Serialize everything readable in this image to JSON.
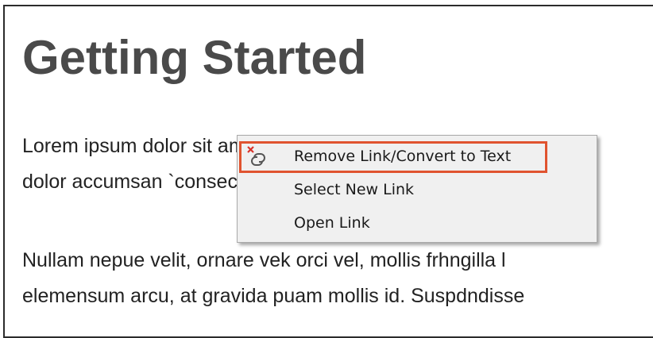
{
  "document": {
    "title": "Getting Started",
    "paragraph1": {
      "line1": "Lorem ipsum dolor sit amet, consectetur adipiscing elit. N",
      "line2": "dolor accumsan `consectetur sit amet"
    },
    "paragraph2": {
      "line1": "Nullam nepue velit, ornare vek orci vel, mollis frhngilla l",
      "line2": "elemensum arcu, at gravida puam mollis id. Suspdndisse"
    }
  },
  "context_menu": {
    "items": [
      {
        "label": "Remove Link/Convert to Text",
        "icon": "unlink-icon",
        "highlighted": true
      },
      {
        "label": "Select New Link",
        "icon": null,
        "highlighted": false
      },
      {
        "label": "Open Link",
        "icon": null,
        "highlighted": false
      }
    ]
  },
  "colors": {
    "title_text": "#4a4a4a",
    "body_text": "#222222",
    "menu_background": "#f0f0f0",
    "highlight_border": "#e0532f",
    "icon_x": "#d9342b"
  }
}
